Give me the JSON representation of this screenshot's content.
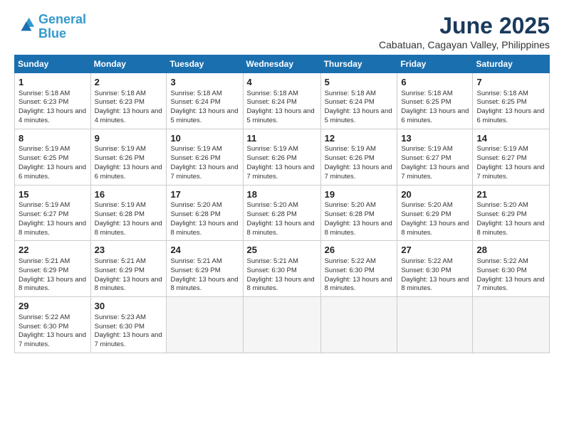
{
  "logo": {
    "line1": "General",
    "line2": "Blue"
  },
  "title": "June 2025",
  "location": "Cabatuan, Cagayan Valley, Philippines",
  "weekdays": [
    "Sunday",
    "Monday",
    "Tuesday",
    "Wednesday",
    "Thursday",
    "Friday",
    "Saturday"
  ],
  "weeks": [
    [
      {
        "day": "1",
        "sunrise": "5:18 AM",
        "sunset": "6:23 PM",
        "daylight": "13 hours and 4 minutes."
      },
      {
        "day": "2",
        "sunrise": "5:18 AM",
        "sunset": "6:23 PM",
        "daylight": "13 hours and 4 minutes."
      },
      {
        "day": "3",
        "sunrise": "5:18 AM",
        "sunset": "6:24 PM",
        "daylight": "13 hours and 5 minutes."
      },
      {
        "day": "4",
        "sunrise": "5:18 AM",
        "sunset": "6:24 PM",
        "daylight": "13 hours and 5 minutes."
      },
      {
        "day": "5",
        "sunrise": "5:18 AM",
        "sunset": "6:24 PM",
        "daylight": "13 hours and 5 minutes."
      },
      {
        "day": "6",
        "sunrise": "5:18 AM",
        "sunset": "6:25 PM",
        "daylight": "13 hours and 6 minutes."
      },
      {
        "day": "7",
        "sunrise": "5:18 AM",
        "sunset": "6:25 PM",
        "daylight": "13 hours and 6 minutes."
      }
    ],
    [
      {
        "day": "8",
        "sunrise": "5:19 AM",
        "sunset": "6:25 PM",
        "daylight": "13 hours and 6 minutes."
      },
      {
        "day": "9",
        "sunrise": "5:19 AM",
        "sunset": "6:26 PM",
        "daylight": "13 hours and 6 minutes."
      },
      {
        "day": "10",
        "sunrise": "5:19 AM",
        "sunset": "6:26 PM",
        "daylight": "13 hours and 7 minutes."
      },
      {
        "day": "11",
        "sunrise": "5:19 AM",
        "sunset": "6:26 PM",
        "daylight": "13 hours and 7 minutes."
      },
      {
        "day": "12",
        "sunrise": "5:19 AM",
        "sunset": "6:26 PM",
        "daylight": "13 hours and 7 minutes."
      },
      {
        "day": "13",
        "sunrise": "5:19 AM",
        "sunset": "6:27 PM",
        "daylight": "13 hours and 7 minutes."
      },
      {
        "day": "14",
        "sunrise": "5:19 AM",
        "sunset": "6:27 PM",
        "daylight": "13 hours and 7 minutes."
      }
    ],
    [
      {
        "day": "15",
        "sunrise": "5:19 AM",
        "sunset": "6:27 PM",
        "daylight": "13 hours and 8 minutes."
      },
      {
        "day": "16",
        "sunrise": "5:19 AM",
        "sunset": "6:28 PM",
        "daylight": "13 hours and 8 minutes."
      },
      {
        "day": "17",
        "sunrise": "5:20 AM",
        "sunset": "6:28 PM",
        "daylight": "13 hours and 8 minutes."
      },
      {
        "day": "18",
        "sunrise": "5:20 AM",
        "sunset": "6:28 PM",
        "daylight": "13 hours and 8 minutes."
      },
      {
        "day": "19",
        "sunrise": "5:20 AM",
        "sunset": "6:28 PM",
        "daylight": "13 hours and 8 minutes."
      },
      {
        "day": "20",
        "sunrise": "5:20 AM",
        "sunset": "6:29 PM",
        "daylight": "13 hours and 8 minutes."
      },
      {
        "day": "21",
        "sunrise": "5:20 AM",
        "sunset": "6:29 PM",
        "daylight": "13 hours and 8 minutes."
      }
    ],
    [
      {
        "day": "22",
        "sunrise": "5:21 AM",
        "sunset": "6:29 PM",
        "daylight": "13 hours and 8 minutes."
      },
      {
        "day": "23",
        "sunrise": "5:21 AM",
        "sunset": "6:29 PM",
        "daylight": "13 hours and 8 minutes."
      },
      {
        "day": "24",
        "sunrise": "5:21 AM",
        "sunset": "6:29 PM",
        "daylight": "13 hours and 8 minutes."
      },
      {
        "day": "25",
        "sunrise": "5:21 AM",
        "sunset": "6:30 PM",
        "daylight": "13 hours and 8 minutes."
      },
      {
        "day": "26",
        "sunrise": "5:22 AM",
        "sunset": "6:30 PM",
        "daylight": "13 hours and 8 minutes."
      },
      {
        "day": "27",
        "sunrise": "5:22 AM",
        "sunset": "6:30 PM",
        "daylight": "13 hours and 8 minutes."
      },
      {
        "day": "28",
        "sunrise": "5:22 AM",
        "sunset": "6:30 PM",
        "daylight": "13 hours and 7 minutes."
      }
    ],
    [
      {
        "day": "29",
        "sunrise": "5:22 AM",
        "sunset": "6:30 PM",
        "daylight": "13 hours and 7 minutes."
      },
      {
        "day": "30",
        "sunrise": "5:23 AM",
        "sunset": "6:30 PM",
        "daylight": "13 hours and 7 minutes."
      },
      null,
      null,
      null,
      null,
      null
    ]
  ],
  "labels": {
    "sunrise": "Sunrise: ",
    "sunset": "Sunset: ",
    "daylight": "Daylight: "
  }
}
